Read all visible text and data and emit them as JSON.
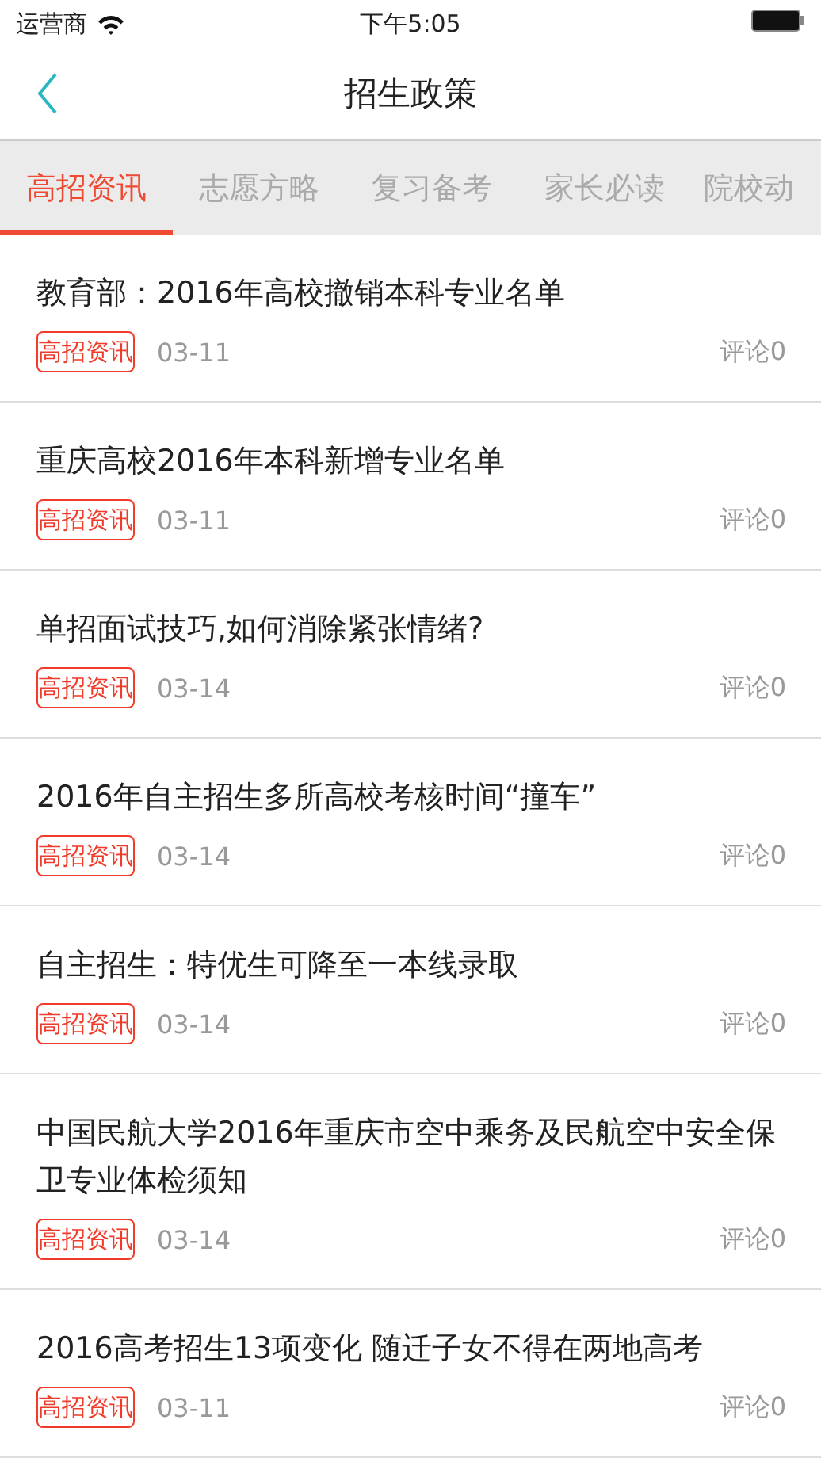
{
  "status_bar": {
    "carrier": "运营商",
    "time": "下午5:05"
  },
  "nav": {
    "title": "招生政策"
  },
  "tabs": [
    {
      "label": "高招资讯",
      "selected": true
    },
    {
      "label": "志愿方略",
      "selected": false
    },
    {
      "label": "复习备考",
      "selected": false
    },
    {
      "label": "家长必读",
      "selected": false
    },
    {
      "label": "院校动",
      "selected": false
    }
  ],
  "articles": [
    {
      "title": "教育部：2016年高校撤销本科专业名单",
      "tag": "高招资讯",
      "date": "03-11",
      "comments": "评论0"
    },
    {
      "title": "重庆高校2016年本科新增专业名单",
      "tag": "高招资讯",
      "date": "03-11",
      "comments": "评论0"
    },
    {
      "title": "单招面试技巧,如何消除紧张情绪?",
      "tag": "高招资讯",
      "date": "03-14",
      "comments": "评论0"
    },
    {
      "title": "2016年自主招生多所高校考核时间“撞车”",
      "tag": "高招资讯",
      "date": "03-14",
      "comments": "评论0"
    },
    {
      "title": "自主招生：特优生可降至一本线录取",
      "tag": "高招资讯",
      "date": "03-14",
      "comments": "评论0"
    },
    {
      "title": "中国民航大学2016年重庆市空中乘务及民航空中安全保卫专业体检须知",
      "tag": "高招资讯",
      "date": "03-14",
      "comments": "评论0"
    },
    {
      "title": "2016高考招生13项变化 随迁子女不得在两地高考",
      "tag": "高招资讯",
      "date": "03-11",
      "comments": "评论0"
    }
  ]
}
